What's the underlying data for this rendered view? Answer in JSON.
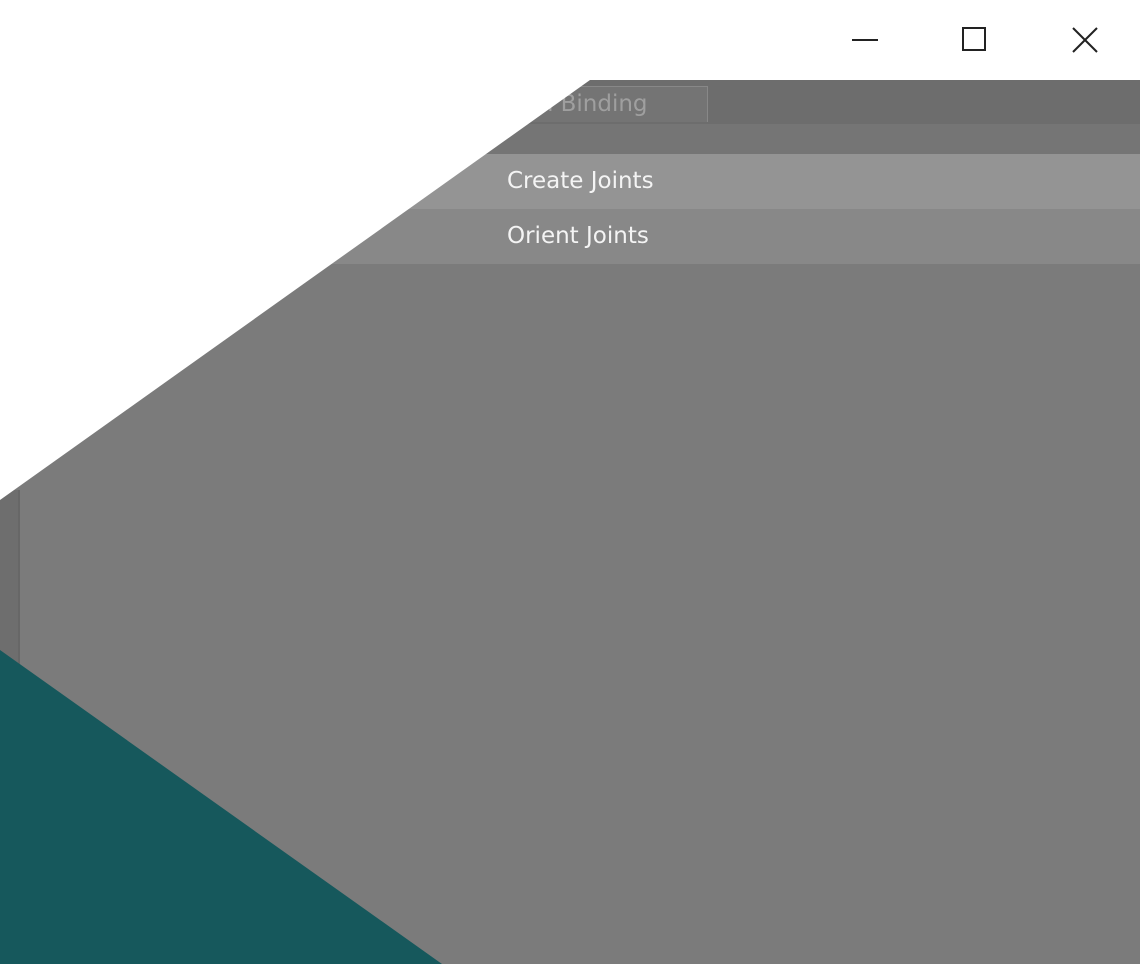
{
  "window": {
    "controls": {
      "minimize_icon": "minimize-icon",
      "maximize_icon": "maximize-icon",
      "close_icon": "close-icon"
    }
  },
  "tabs": [
    {
      "label": "kin Binding"
    }
  ],
  "menu": {
    "items": [
      {
        "label": "Create Joints",
        "highlighted": true
      },
      {
        "label": "Orient Joints",
        "highlighted": false
      }
    ]
  },
  "colors": {
    "panel_background": "#7b7b7b",
    "highlight_row": "#949494",
    "row": "#888888",
    "teal_accent": "#16585c",
    "overlay_white": "#ffffff"
  }
}
